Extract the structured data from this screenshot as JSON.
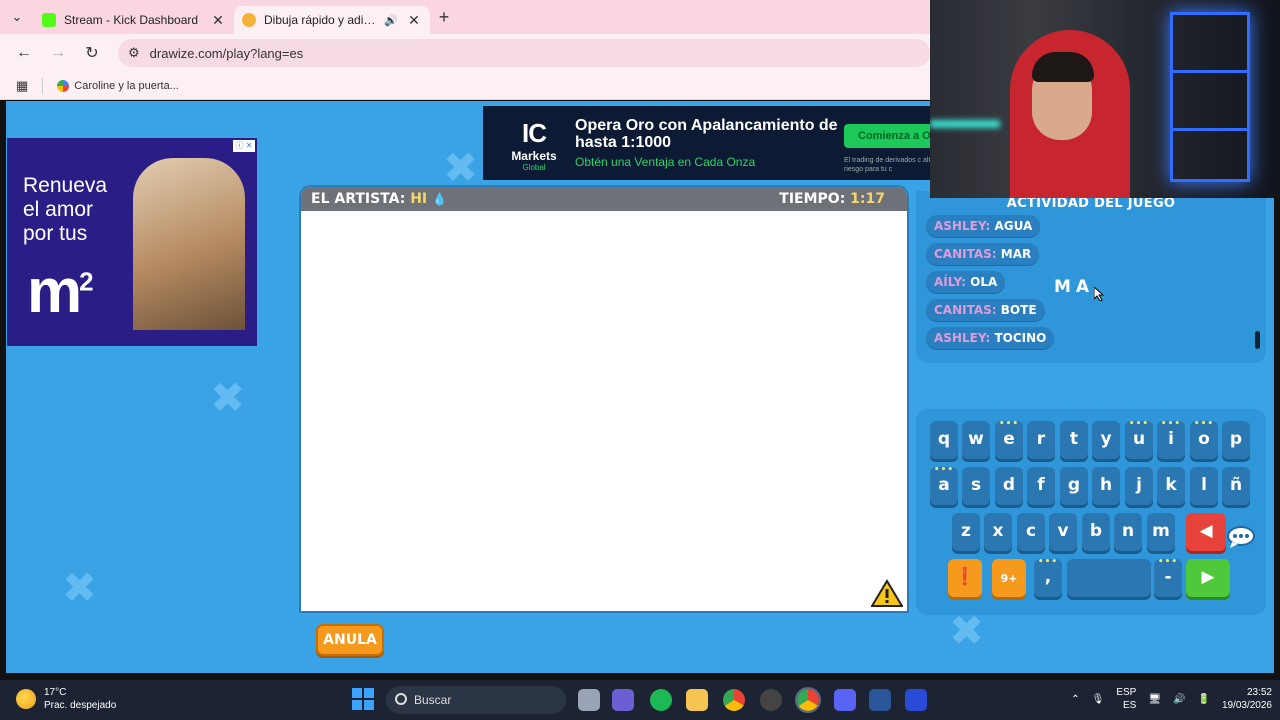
{
  "browser": {
    "tabs": [
      {
        "title": "Stream - Kick Dashboard",
        "active": false,
        "favicon_color": "#53fc18"
      },
      {
        "title": "Dibuja rápido y adivina",
        "active": true,
        "favicon_color": "#f3b23a"
      }
    ],
    "url": "drawize.com/play?lang=es",
    "bookmarks": [
      {
        "label": "Caroline y la puerta..."
      }
    ]
  },
  "ads": {
    "left": {
      "line1": "Renueva",
      "line2": "el amor",
      "line3": "por tus",
      "brand": "m",
      "brand_sup": "2"
    },
    "top": {
      "logo_ic": "IC",
      "logo_markets": "Markets",
      "logo_global": "Global",
      "headline": "Opera Oro con Apalancamiento de hasta 1:1000",
      "subline": "Obtén una Ventaja en Cada Onza",
      "cta": "Comienza a Op",
      "fine": "El trading de derivados c alto riesgo para tu c"
    }
  },
  "game": {
    "artist_label": "EL ARTISTA:",
    "artist_name": "HI",
    "time_label": "TIEMPO:",
    "time_value": "1:17",
    "anula_label": "ANULA",
    "activity_title": "ACTIVIDAD DEL JUEGO",
    "activity": [
      {
        "user": "ASHLEY:",
        "guess": "AGUA"
      },
      {
        "user": "CANITAS:",
        "guess": "MAR"
      },
      {
        "user": "AÍLY:",
        "guess": "OLA"
      },
      {
        "user": "CANITAS:",
        "guess": "BOTE"
      },
      {
        "user": "ASHLEY:",
        "guess": "TOCINO"
      }
    ],
    "current_word": "MA",
    "keyboard": {
      "row1": [
        "q",
        "w",
        "e",
        "r",
        "t",
        "y",
        "u",
        "i",
        "o",
        "p"
      ],
      "row2": [
        "a",
        "s",
        "d",
        "f",
        "g",
        "h",
        "j",
        "k",
        "l",
        "ñ"
      ],
      "row3": [
        "z",
        "x",
        "c",
        "v",
        "b",
        "n",
        "m"
      ],
      "row4_comma": ",",
      "row4_dash": "-",
      "hint_badge": "9+"
    }
  },
  "taskbar": {
    "temperature": "17°C",
    "weather_desc": "Prac. despejado",
    "search_placeholder": "Buscar",
    "lang_top": "ESP",
    "lang_bottom": "ES",
    "time": "23:52",
    "date": "19/03/2026"
  },
  "colors": {
    "page_bg": "#3aa3e6",
    "panel_bg": "#2f96d9",
    "key_bg": "#2a77b1",
    "accent_orange": "#f59a1d",
    "accent_green": "#4fc83a",
    "accent_red": "#e7433a"
  }
}
